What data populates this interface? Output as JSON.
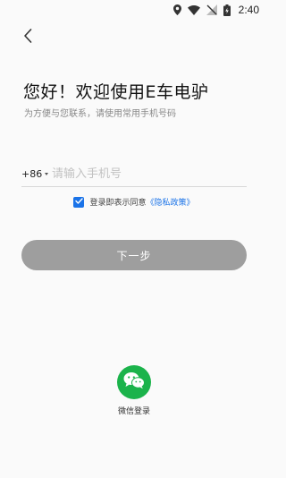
{
  "status_bar": {
    "time": "2:40",
    "icons": [
      "location-icon",
      "wifi-icon",
      "no-signal-icon",
      "battery-charging-icon"
    ]
  },
  "header": {
    "back_icon": "chevron-left-icon"
  },
  "main": {
    "title": "您好！欢迎使用E车电驴",
    "subtitle": "为方便与您联系，请使用常用手机号码",
    "country_code": "+86",
    "phone_placeholder": "请输入手机号",
    "phone_value": "",
    "agreement_prefix": "登录即表示同意",
    "agreement_link": "《隐私政策》",
    "agreement_checked": true,
    "next_button": "下一步"
  },
  "third_party": {
    "wechat_label": "微信登录"
  },
  "colors": {
    "accent": "#1a73e8",
    "button_disabled": "#9e9e9e",
    "wechat_green": "#1bb34b"
  }
}
